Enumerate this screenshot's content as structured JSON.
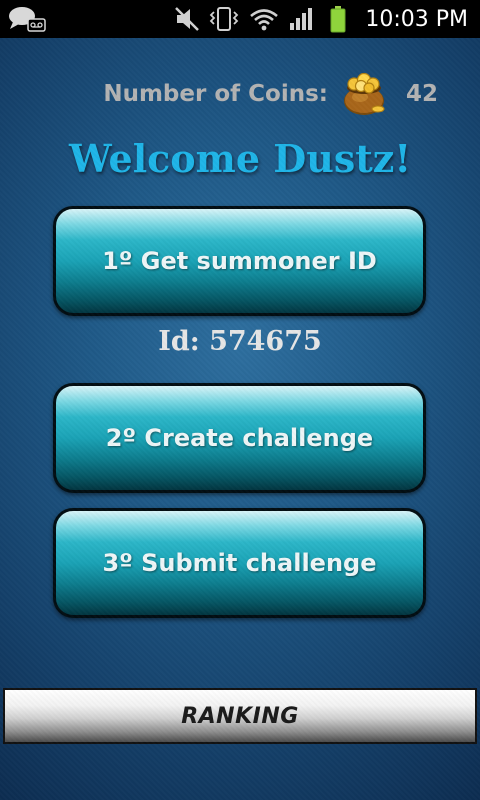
{
  "status_bar": {
    "time": "10:03 PM",
    "icons": [
      "chat-voicemail-icon",
      "mute-icon",
      "vibrate-icon",
      "wifi-icon",
      "signal-icon",
      "battery-icon"
    ],
    "battery_color": "#8fd43c"
  },
  "coins": {
    "label": "Number of Coins:",
    "value": "42",
    "icon": "gold-pot-icon"
  },
  "welcome": "Welcome Dustz!",
  "buttons": {
    "get_id": "1º Get summoner ID",
    "create": "2º Create challenge",
    "submit": "3º Submit challenge",
    "ranking": "RANKING"
  },
  "id_line": "Id: 574675",
  "colors": {
    "welcome_text": "#1fb5e8",
    "button_teal": "#1aa3b6",
    "background": "#1f5987"
  }
}
